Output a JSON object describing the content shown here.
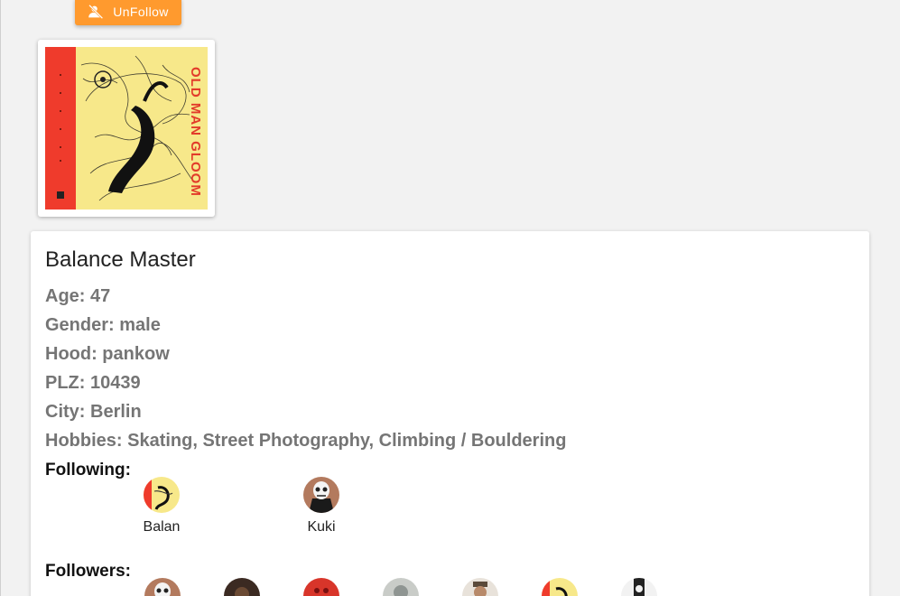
{
  "toolbar": {
    "unfollow_label": "UnFollow"
  },
  "profile": {
    "name": "Balance Master",
    "age": "Age: 47",
    "gender": "Gender: male",
    "hood": "Hood: pankow",
    "plz": "PLZ: 10439",
    "city": "City: Berlin",
    "hobbies": "Hobbies: Skating, Street Photography, Climbing / Bouldering"
  },
  "following": {
    "label": "Following:",
    "people": [
      {
        "name": "Balan"
      },
      {
        "name": "Kuki"
      }
    ]
  },
  "followers": {
    "label": "Followers:"
  },
  "colors": {
    "accent": "#ff9a2e",
    "cover_red": "#ef3b2c",
    "cover_yellow": "#f7e88a",
    "text_muted": "#757575"
  },
  "icons": {
    "unfollow": "remove-person-icon"
  }
}
